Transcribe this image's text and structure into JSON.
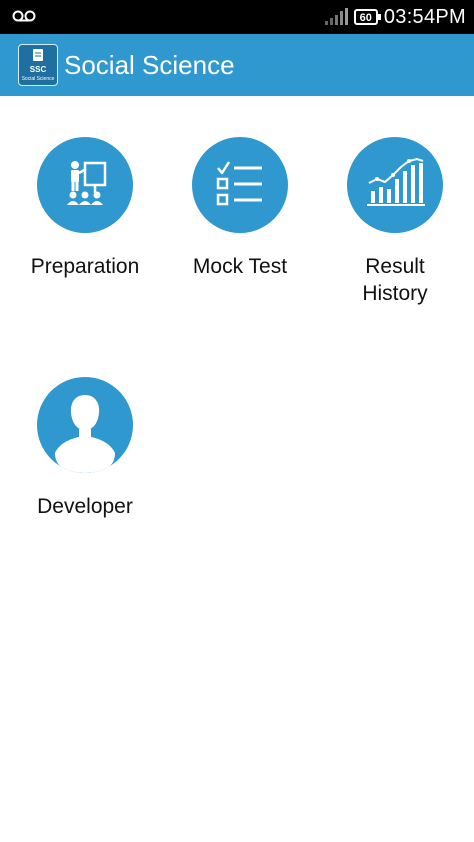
{
  "status_bar": {
    "time": "03:54PM",
    "battery": "60",
    "icons": [
      "voicemail-icon",
      "signal-icon",
      "battery-icon"
    ]
  },
  "app_bar": {
    "title": "Social Science",
    "logo_text_top": "SSC",
    "logo_text_bottom": "Social Science"
  },
  "menu": {
    "preparation": "Preparation",
    "mock_test": "Mock Test",
    "result_history_line1": "Result",
    "result_history_line2": "History",
    "developer": "Developer"
  },
  "colors": {
    "accent": "#2e98cf",
    "status_bar": "#000000",
    "label_text": "#111111"
  }
}
